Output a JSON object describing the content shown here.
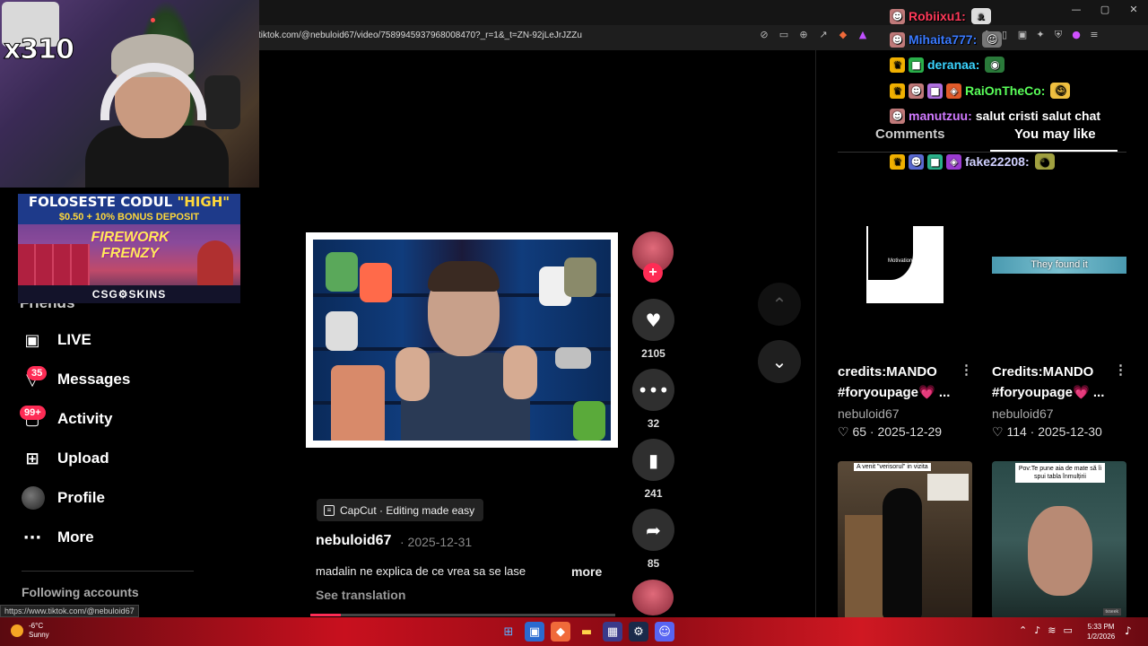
{
  "browser": {
    "url": "tiktok.com/@nebuloid67/video/7589945937968008470?_r=1&_t=ZN-92jLeJrJZZu",
    "window_controls": [
      "—",
      "▢",
      "✕"
    ],
    "address_icons": [
      "eye-off-icon",
      "cast-icon",
      "zoom-icon",
      "share-icon",
      "brave-shield-icon",
      "brave-rewards-icon"
    ],
    "extension_icons": [
      "music-icon",
      "sidebar-icon",
      "wallet-icon",
      "puzzle-icon",
      "vpn-icon",
      "leo-icon",
      "menu-icon"
    ]
  },
  "stream": {
    "combo": "x310",
    "chat": [
      {
        "user": "Robiixu1:",
        "user_color": "#ff3a5a",
        "badges": [
          "avatar"
        ],
        "message": "",
        "emote": "cat"
      },
      {
        "user": "Mihaita777:",
        "user_color": "#3a7aff",
        "badges": [
          "avatar"
        ],
        "message": "",
        "emote": "face"
      },
      {
        "user": "deranaa:",
        "user_color": "#3ad4ff",
        "badges": [
          "crown",
          "gift"
        ],
        "message": "",
        "emote": "frog"
      },
      {
        "user": "RaiOnTheCo:",
        "user_color": "#5aff5a",
        "badges": [
          "crown",
          "avatar",
          "gift",
          "sub"
        ],
        "message": "",
        "emote": "emoji"
      },
      {
        "user": "manutzuu:",
        "user_color": "#d07aff",
        "badges": [
          "avatar"
        ],
        "message": "salut cristi salut chat",
        "emote": ""
      },
      {
        "user": "fake22208:",
        "user_color": "#d0d0ff",
        "badges": [
          "crown",
          "avatar",
          "gift",
          "sub"
        ],
        "message": "",
        "emote": "dog"
      }
    ]
  },
  "ad": {
    "line1_prefix": "FOLOSESTE CODUL",
    "line1_code": "\"HIGH\"",
    "line2": "$0.50 + 10% BONUS DEPOSIT",
    "game": "FIREWORK FRENZY",
    "brand": "CSG⚙SKINS"
  },
  "nav": {
    "friends": "Friends",
    "items": [
      {
        "label": "LIVE",
        "icon": "live-icon"
      },
      {
        "label": "Messages",
        "icon": "messages-icon",
        "badge": "35"
      },
      {
        "label": "Activity",
        "icon": "activity-icon",
        "badge": "99+"
      },
      {
        "label": "Upload",
        "icon": "upload-icon"
      },
      {
        "label": "Profile",
        "icon": "profile-avatar"
      },
      {
        "label": "More",
        "icon": "more-icon"
      }
    ],
    "following_accounts": "Following accounts",
    "status_url": "https://www.tiktok.com/@nebuloid67"
  },
  "video": {
    "likes": "2105",
    "comments": "32",
    "saves": "241",
    "shares": "85",
    "capcut_label": "CapCut · Editing made easy",
    "author": "nebuloid67",
    "date": "· 2025-12-31",
    "description": "madalin ne explica de ce vrea sa se lase",
    "more": "more",
    "see_translation": "See translation",
    "progress": 0.1
  },
  "panel": {
    "tabs": [
      "Comments",
      "You may like"
    ],
    "videos": [
      {
        "title": "credits:MANDO #foryoupage💗 ...",
        "author": "nebuloid67",
        "likes": "65",
        "date": "2025-12-29",
        "thumb_caption": "Motivation?"
      },
      {
        "title": "Credits:MANDO #foryoupage💗 ...",
        "author": "nebuloid67",
        "likes": "114",
        "date": "2025-12-30",
        "thumb_caption": "They found it"
      },
      {
        "thumb_caption": "A venit \"verisorul\" in vizita"
      },
      {
        "thumb_caption": "Pov:Te pune aia de mate să îi spui tabla înmulțirii",
        "badge": "tvseek"
      }
    ]
  },
  "taskbar": {
    "temp": "-6°C",
    "weather": "Sunny",
    "time": "5:33 PM",
    "date": "1/2/2026"
  },
  "colors": {
    "accent": "#fe2c55",
    "taskbar": "#c8101e"
  }
}
